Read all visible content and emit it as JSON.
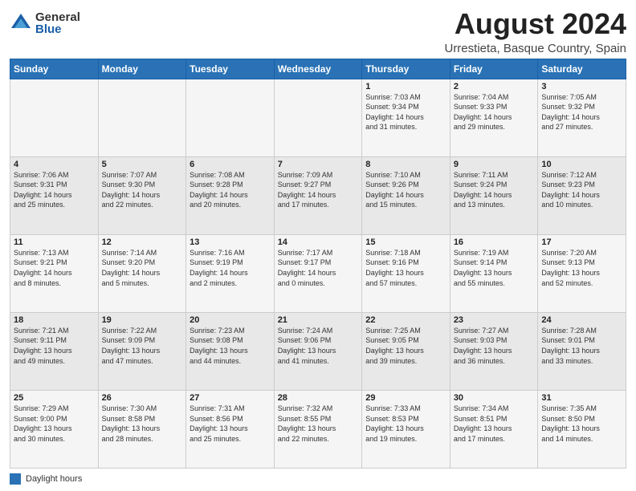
{
  "logo": {
    "general": "General",
    "blue": "Blue"
  },
  "header": {
    "title": "August 2024",
    "subtitle": "Urrestieta, Basque Country, Spain"
  },
  "weekdays": [
    "Sunday",
    "Monday",
    "Tuesday",
    "Wednesday",
    "Thursday",
    "Friday",
    "Saturday"
  ],
  "weeks": [
    [
      null,
      null,
      null,
      null,
      {
        "day": 1,
        "sunrise": "7:03 AM",
        "sunset": "9:34 PM",
        "hours": "14 hours",
        "minutes": "31 minutes"
      },
      {
        "day": 2,
        "sunrise": "7:04 AM",
        "sunset": "9:33 PM",
        "hours": "14 hours",
        "minutes": "29 minutes"
      },
      {
        "day": 3,
        "sunrise": "7:05 AM",
        "sunset": "9:32 PM",
        "hours": "14 hours",
        "minutes": "27 minutes"
      }
    ],
    [
      {
        "day": 4,
        "sunrise": "7:06 AM",
        "sunset": "9:31 PM",
        "hours": "14 hours",
        "minutes": "25 minutes"
      },
      {
        "day": 5,
        "sunrise": "7:07 AM",
        "sunset": "9:30 PM",
        "hours": "14 hours",
        "minutes": "22 minutes"
      },
      {
        "day": 6,
        "sunrise": "7:08 AM",
        "sunset": "9:28 PM",
        "hours": "14 hours",
        "minutes": "20 minutes"
      },
      {
        "day": 7,
        "sunrise": "7:09 AM",
        "sunset": "9:27 PM",
        "hours": "14 hours",
        "minutes": "17 minutes"
      },
      {
        "day": 8,
        "sunrise": "7:10 AM",
        "sunset": "9:26 PM",
        "hours": "14 hours",
        "minutes": "15 minutes"
      },
      {
        "day": 9,
        "sunrise": "7:11 AM",
        "sunset": "9:24 PM",
        "hours": "14 hours",
        "minutes": "13 minutes"
      },
      {
        "day": 10,
        "sunrise": "7:12 AM",
        "sunset": "9:23 PM",
        "hours": "14 hours",
        "minutes": "10 minutes"
      }
    ],
    [
      {
        "day": 11,
        "sunrise": "7:13 AM",
        "sunset": "9:21 PM",
        "hours": "14 hours",
        "minutes": "8 minutes"
      },
      {
        "day": 12,
        "sunrise": "7:14 AM",
        "sunset": "9:20 PM",
        "hours": "14 hours",
        "minutes": "5 minutes"
      },
      {
        "day": 13,
        "sunrise": "7:16 AM",
        "sunset": "9:19 PM",
        "hours": "14 hours",
        "minutes": "2 minutes"
      },
      {
        "day": 14,
        "sunrise": "7:17 AM",
        "sunset": "9:17 PM",
        "hours": "14 hours",
        "minutes": "0 minutes"
      },
      {
        "day": 15,
        "sunrise": "7:18 AM",
        "sunset": "9:16 PM",
        "hours": "13 hours",
        "minutes": "57 minutes"
      },
      {
        "day": 16,
        "sunrise": "7:19 AM",
        "sunset": "9:14 PM",
        "hours": "13 hours",
        "minutes": "55 minutes"
      },
      {
        "day": 17,
        "sunrise": "7:20 AM",
        "sunset": "9:13 PM",
        "hours": "13 hours",
        "minutes": "52 minutes"
      }
    ],
    [
      {
        "day": 18,
        "sunrise": "7:21 AM",
        "sunset": "9:11 PM",
        "hours": "13 hours",
        "minutes": "49 minutes"
      },
      {
        "day": 19,
        "sunrise": "7:22 AM",
        "sunset": "9:09 PM",
        "hours": "13 hours",
        "minutes": "47 minutes"
      },
      {
        "day": 20,
        "sunrise": "7:23 AM",
        "sunset": "9:08 PM",
        "hours": "13 hours",
        "minutes": "44 minutes"
      },
      {
        "day": 21,
        "sunrise": "7:24 AM",
        "sunset": "9:06 PM",
        "hours": "13 hours",
        "minutes": "41 minutes"
      },
      {
        "day": 22,
        "sunrise": "7:25 AM",
        "sunset": "9:05 PM",
        "hours": "13 hours",
        "minutes": "39 minutes"
      },
      {
        "day": 23,
        "sunrise": "7:27 AM",
        "sunset": "9:03 PM",
        "hours": "13 hours",
        "minutes": "36 minutes"
      },
      {
        "day": 24,
        "sunrise": "7:28 AM",
        "sunset": "9:01 PM",
        "hours": "13 hours",
        "minutes": "33 minutes"
      }
    ],
    [
      {
        "day": 25,
        "sunrise": "7:29 AM",
        "sunset": "9:00 PM",
        "hours": "13 hours",
        "minutes": "30 minutes"
      },
      {
        "day": 26,
        "sunrise": "7:30 AM",
        "sunset": "8:58 PM",
        "hours": "13 hours",
        "minutes": "28 minutes"
      },
      {
        "day": 27,
        "sunrise": "7:31 AM",
        "sunset": "8:56 PM",
        "hours": "13 hours",
        "minutes": "25 minutes"
      },
      {
        "day": 28,
        "sunrise": "7:32 AM",
        "sunset": "8:55 PM",
        "hours": "13 hours",
        "minutes": "22 minutes"
      },
      {
        "day": 29,
        "sunrise": "7:33 AM",
        "sunset": "8:53 PM",
        "hours": "13 hours",
        "minutes": "19 minutes"
      },
      {
        "day": 30,
        "sunrise": "7:34 AM",
        "sunset": "8:51 PM",
        "hours": "13 hours",
        "minutes": "17 minutes"
      },
      {
        "day": 31,
        "sunrise": "7:35 AM",
        "sunset": "8:50 PM",
        "hours": "13 hours",
        "minutes": "14 minutes"
      }
    ]
  ],
  "footer": {
    "legend_label": "Daylight hours"
  }
}
